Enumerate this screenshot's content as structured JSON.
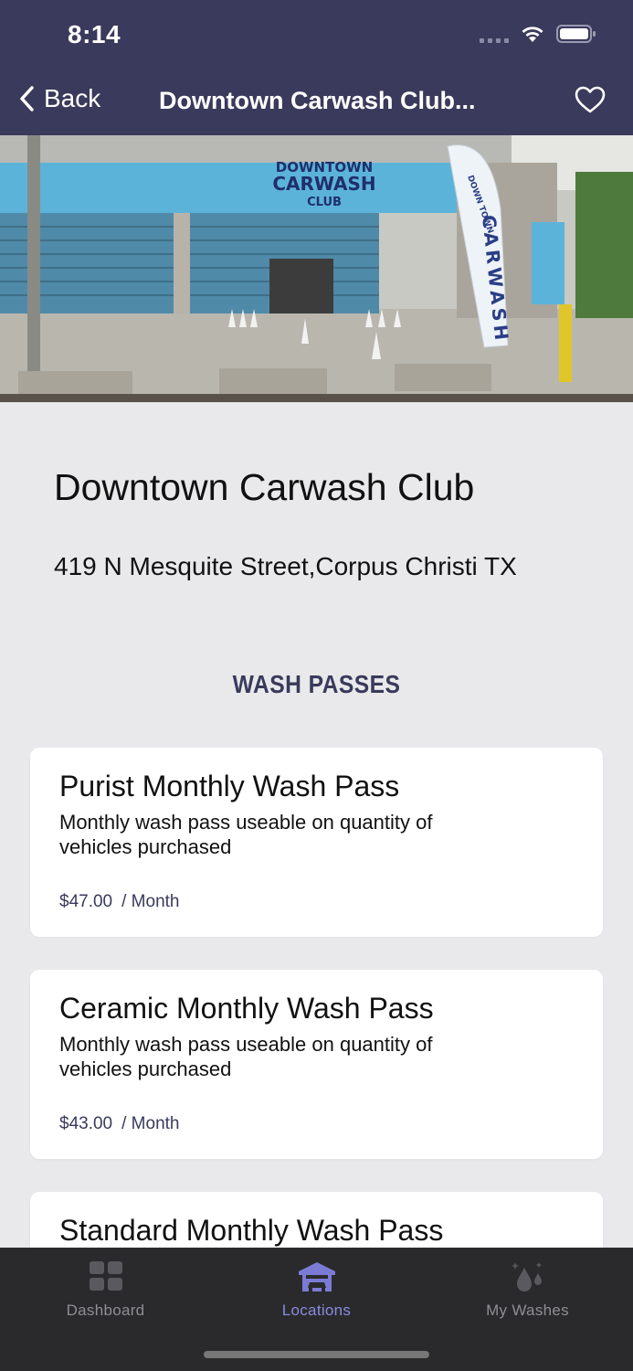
{
  "status": {
    "time": "8:14"
  },
  "nav": {
    "back_label": "Back",
    "title": "Downtown Carwash Club..."
  },
  "hero": {
    "sign_lines": [
      "DOWNTOWN",
      "CARWASH",
      "CLUB"
    ],
    "flag_text": "CARWASH",
    "flag_top": "DOWN TOWN"
  },
  "location": {
    "name": "Downtown Carwash Club",
    "address": "419 N Mesquite Street,Corpus Christi TX"
  },
  "passes_section": {
    "title": "WASH PASSES",
    "items": [
      {
        "name": "Purist Monthly Wash Pass",
        "description": "Monthly wash pass useable on quantity of vehicles purchased",
        "price": "$47.00",
        "period": "/ Month"
      },
      {
        "name": "Ceramic Monthly Wash Pass",
        "description": "Monthly wash pass useable on quantity of vehicles purchased",
        "price": "$43.00",
        "period": "/ Month"
      },
      {
        "name": "Standard Monthly Wash Pass"
      }
    ]
  },
  "tabbar": {
    "tabs": [
      {
        "label": "Dashboard",
        "icon": "dashboard-grid-icon"
      },
      {
        "label": "Locations",
        "icon": "carwash-building-icon",
        "active": true
      },
      {
        "label": "My Washes",
        "icon": "water-drops-icon"
      }
    ]
  },
  "colors": {
    "nav_bg": "#3a3a5c",
    "accent": "#8a8ae0",
    "tab_bg": "#2a2a2c"
  }
}
